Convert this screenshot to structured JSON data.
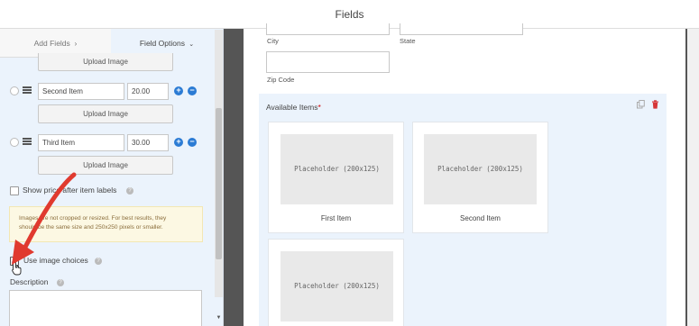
{
  "header": {
    "title": "Fields"
  },
  "tabs": {
    "add_fields": "Add Fields",
    "add_fields_icon": "chevron-right-icon",
    "field_options": "Field Options",
    "field_options_icon": "chevron-down-icon"
  },
  "choices": [
    {
      "label": "Second Item",
      "price": "20.00"
    },
    {
      "label": "Third Item",
      "price": "30.00"
    }
  ],
  "upload_image_label": "Upload Image",
  "show_price_label": "Show price after item labels",
  "show_price_checked": false,
  "notice_lines": [
    "Images are not cropped or resized. For best results, they",
    "should be the same size and 250x250 pixels or smaller."
  ],
  "use_image_choices_label": "Use image choices",
  "use_image_choices_checked": true,
  "description_label": "Description",
  "preview": {
    "city_label": "City",
    "state_label": "State",
    "zip_label": "Zip Code",
    "available_items_label": "Available Items",
    "required_marker": "*",
    "items": [
      {
        "placeholder": "Placeholder (200x125)",
        "label": "First Item"
      },
      {
        "placeholder": "Placeholder (200x125)",
        "label": "Second Item"
      },
      {
        "placeholder": "Placeholder (200x125)",
        "label": ""
      }
    ]
  },
  "colors": {
    "accent_blue": "#2b7bd4",
    "delete_red": "#d63638",
    "panel_bg": "#ebf3fc",
    "arrow_red": "#e03a2f"
  }
}
